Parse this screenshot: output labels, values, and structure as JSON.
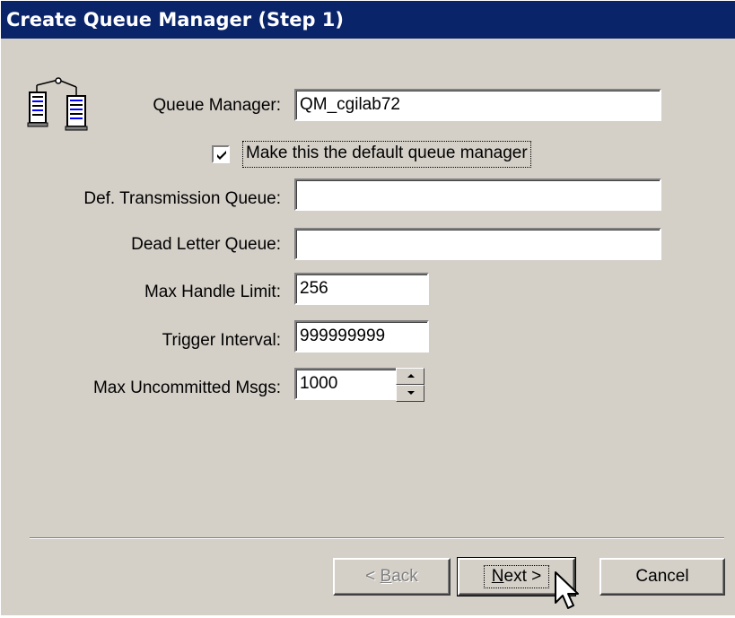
{
  "window": {
    "title": "Create Queue Manager (Step 1)"
  },
  "form": {
    "queue_manager": {
      "label": "Queue Manager:",
      "value": "QM_cgilab72"
    },
    "default_checkbox": {
      "label": "Make this the default queue manager",
      "checked": true
    },
    "def_transmission_queue": {
      "label": "Def. Transmission Queue:",
      "value": ""
    },
    "dead_letter_queue": {
      "label": "Dead Letter Queue:",
      "value": ""
    },
    "max_handle_limit": {
      "label": "Max Handle Limit:",
      "value": "256"
    },
    "trigger_interval": {
      "label": "Trigger Interval:",
      "value": "999999999"
    },
    "max_uncommitted_msgs": {
      "label": "Max Uncommitted Msgs:",
      "value": "1000"
    }
  },
  "buttons": {
    "back": {
      "prefix": "< ",
      "mnemonic": "B",
      "rest": "ack",
      "enabled": false
    },
    "next": {
      "mnemonic": "N",
      "rest": "ext >",
      "default": true
    },
    "cancel": {
      "label": "Cancel"
    }
  },
  "icons": {
    "header_icon": "queue-manager-servers-icon",
    "cursor": "mouse-pointer-icon"
  },
  "colors": {
    "titlebar_bg": "#0a246a",
    "titlebar_fg": "#ffffff",
    "dialog_bg": "#d4d0c8",
    "disabled_text": "#808080"
  }
}
